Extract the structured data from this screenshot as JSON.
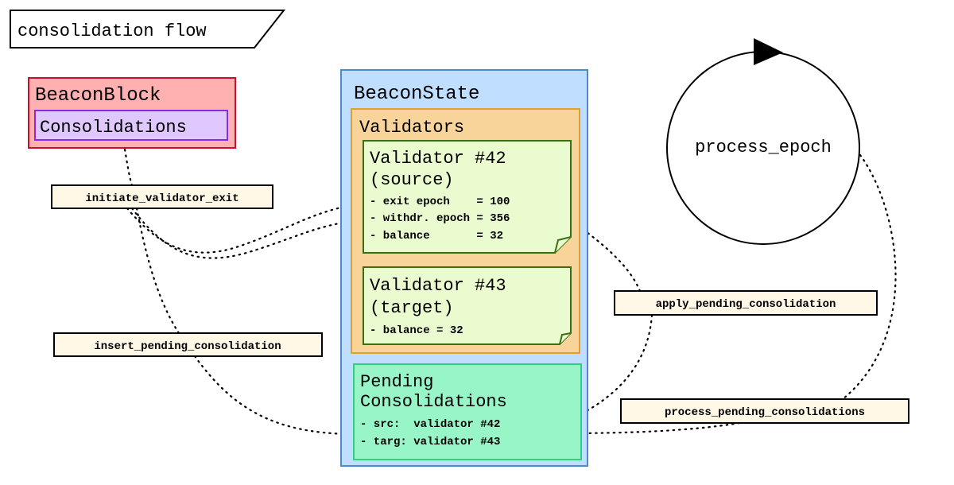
{
  "title": "consolidation flow",
  "colors": {
    "beacon_block_fill": "#ffb0b0",
    "beacon_block_stroke": "#c8102e",
    "consolidations_fill": "#e0c8ff",
    "consolidations_stroke": "#8a2be2",
    "beacon_state_fill": "#c0deff",
    "beacon_state_stroke": "#4a8ad0",
    "validators_fill": "#f8d49a",
    "validators_stroke": "#e0a030",
    "validator_note_fill": "#eafbd0",
    "validator_note_stroke": "#3a7010",
    "pending_fill": "#98f5c8",
    "pending_stroke": "#30d080",
    "edge_label_fill": "#fff8e6"
  },
  "beacon_block": {
    "label": "BeaconBlock",
    "consolidations": "Consolidations"
  },
  "beacon_state": {
    "label": "BeaconState",
    "validators": {
      "label": "Validators",
      "source": {
        "title": "Validator #42",
        "subtitle": "(source)",
        "lines": [
          "- exit epoch    = 100",
          "- withdr. epoch = 356",
          "- balance       = 32"
        ]
      },
      "target": {
        "title": "Validator #43",
        "subtitle": "(target)",
        "lines": [
          "- balance = 32"
        ]
      }
    },
    "pending": {
      "title": [
        "Pending",
        "Consolidations"
      ],
      "lines": [
        "- src:  validator #42",
        "- targ: validator #43"
      ]
    }
  },
  "process_epoch": {
    "label": "process_epoch"
  },
  "edges": {
    "initiate_validator_exit": "initiate_validator_exit",
    "insert_pending_consolidation": "insert_pending_consolidation",
    "apply_pending_consolidation": "apply_pending_consolidation",
    "process_pending_consolidations": "process_pending_consolidations"
  }
}
